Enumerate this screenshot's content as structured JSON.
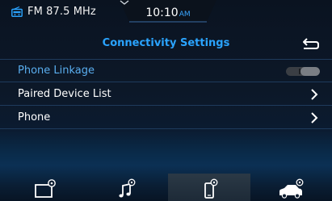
{
  "status_bar": {
    "radio_text": "FM 87.5 MHz",
    "time": "10:10",
    "ampm": "AM"
  },
  "header": {
    "title": "Connectivity Settings"
  },
  "list": {
    "items": [
      {
        "label": "Phone Linkage",
        "control": "toggle"
      },
      {
        "label": "Paired Device List",
        "control": "chevron"
      },
      {
        "label": "Phone",
        "control": "chevron"
      }
    ]
  },
  "bottom_nav": {
    "tabs": [
      {
        "icon": "display-settings-icon",
        "active": false
      },
      {
        "icon": "sound-settings-icon",
        "active": false
      },
      {
        "icon": "phone-settings-icon",
        "active": true
      },
      {
        "icon": "vehicle-settings-icon",
        "active": false
      }
    ]
  },
  "colors": {
    "accent": "#2aa4ff",
    "toggle_off": "#3a3e44",
    "background": "#0c1828"
  }
}
